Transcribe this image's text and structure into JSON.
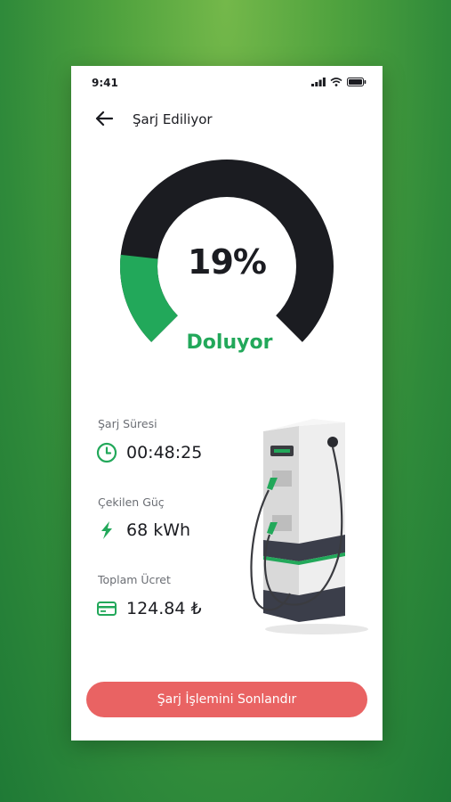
{
  "status_bar": {
    "time": "9:41"
  },
  "header": {
    "title": "Şarj Ediliyor"
  },
  "gauge": {
    "percent_text": "19%",
    "percent_value": 19,
    "status": "Doluyor",
    "fill_color": "#22a85a",
    "track_color": "#1b1c21"
  },
  "stats": {
    "duration": {
      "label": "Şarj Süresi",
      "value": "00:48:25",
      "icon": "clock-icon"
    },
    "power": {
      "label": "Çekilen Güç",
      "value": "68 kWh",
      "icon": "lightning-icon"
    },
    "cost": {
      "label": "Toplam Ücret",
      "value": "124.84 ₺",
      "icon": "card-icon"
    }
  },
  "action": {
    "end_label": "Şarj İşlemini Sonlandır"
  },
  "colors": {
    "accent": "#22a85a",
    "danger": "#e96363",
    "text": "#1b1c21"
  }
}
